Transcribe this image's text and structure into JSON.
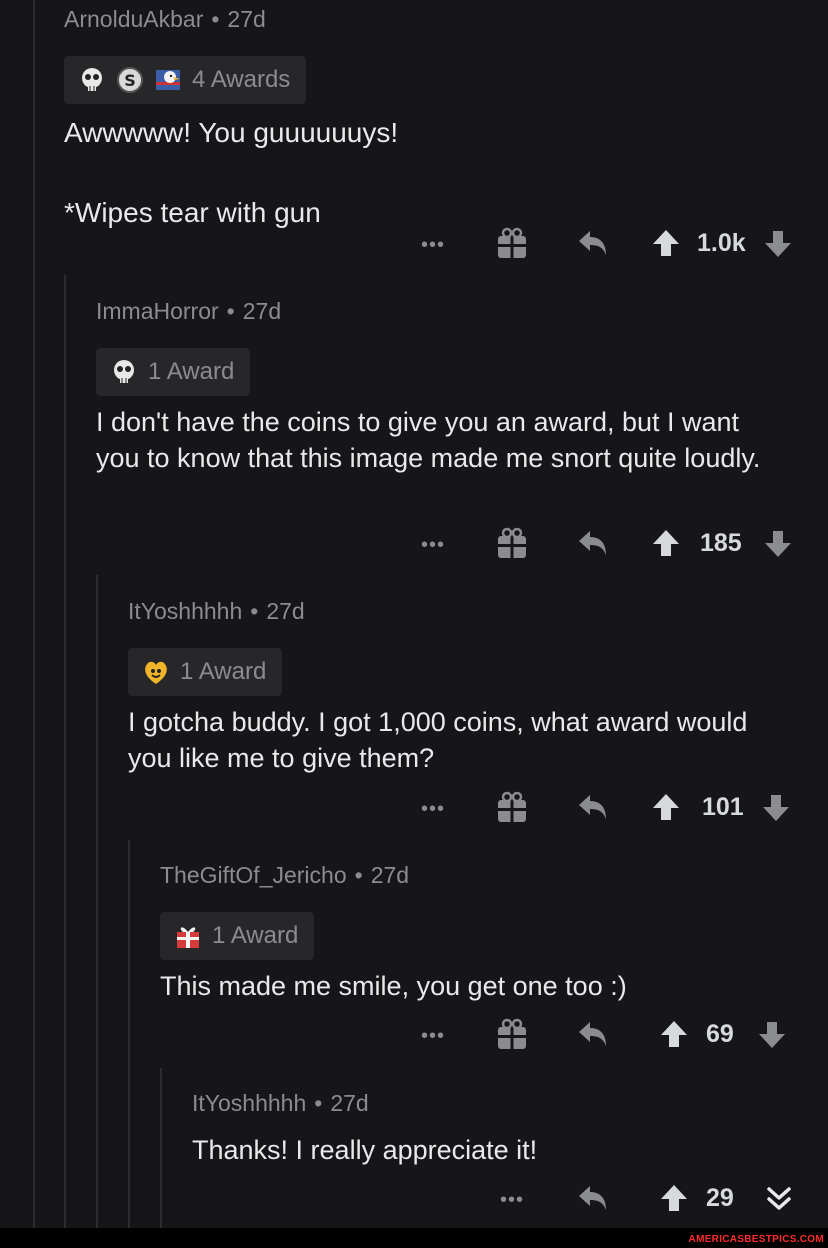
{
  "comments": [
    {
      "author": "ArnolduAkbar",
      "age": "27d",
      "awards_label": "4 Awards",
      "award_icons": [
        "skull-award-icon",
        "silver-award-icon",
        "eagle-award-icon"
      ],
      "text": "Awwwww! You guuuuuuys!\n\n*Wipes tear with gun",
      "score": "1.0k"
    },
    {
      "author": "ImmaHorror",
      "age": "27d",
      "awards_label": "1 Award",
      "award_icons": [
        "skull-award-icon"
      ],
      "text": "I don't have the coins to give you an award, but I want you to know that this image made me snort quite loudly.",
      "score": "185"
    },
    {
      "author": "ItYoshhhhh",
      "age": "27d",
      "awards_label": "1 Award",
      "award_icons": [
        "wholesome-award-icon"
      ],
      "text": "I gotcha buddy. I got 1,000 coins, what award would you like me to give them?",
      "score": "101"
    },
    {
      "author": "TheGiftOf_Jericho",
      "age": "27d",
      "awards_label": "1 Award",
      "award_icons": [
        "gift-award-icon"
      ],
      "text": "This made me smile, you get one too :)",
      "score": "69"
    },
    {
      "author": "ItYoshhhhh",
      "age": "27d",
      "text": "Thanks! I really appreciate it!",
      "score": "29"
    }
  ],
  "separator": "•",
  "more_label": "•••",
  "watermark": "AMERICASBESTPICS.COM",
  "colors": {
    "background": "#161618",
    "muted": "#8a8c8f",
    "text": "#e8e9ea",
    "badge": "#272729"
  }
}
